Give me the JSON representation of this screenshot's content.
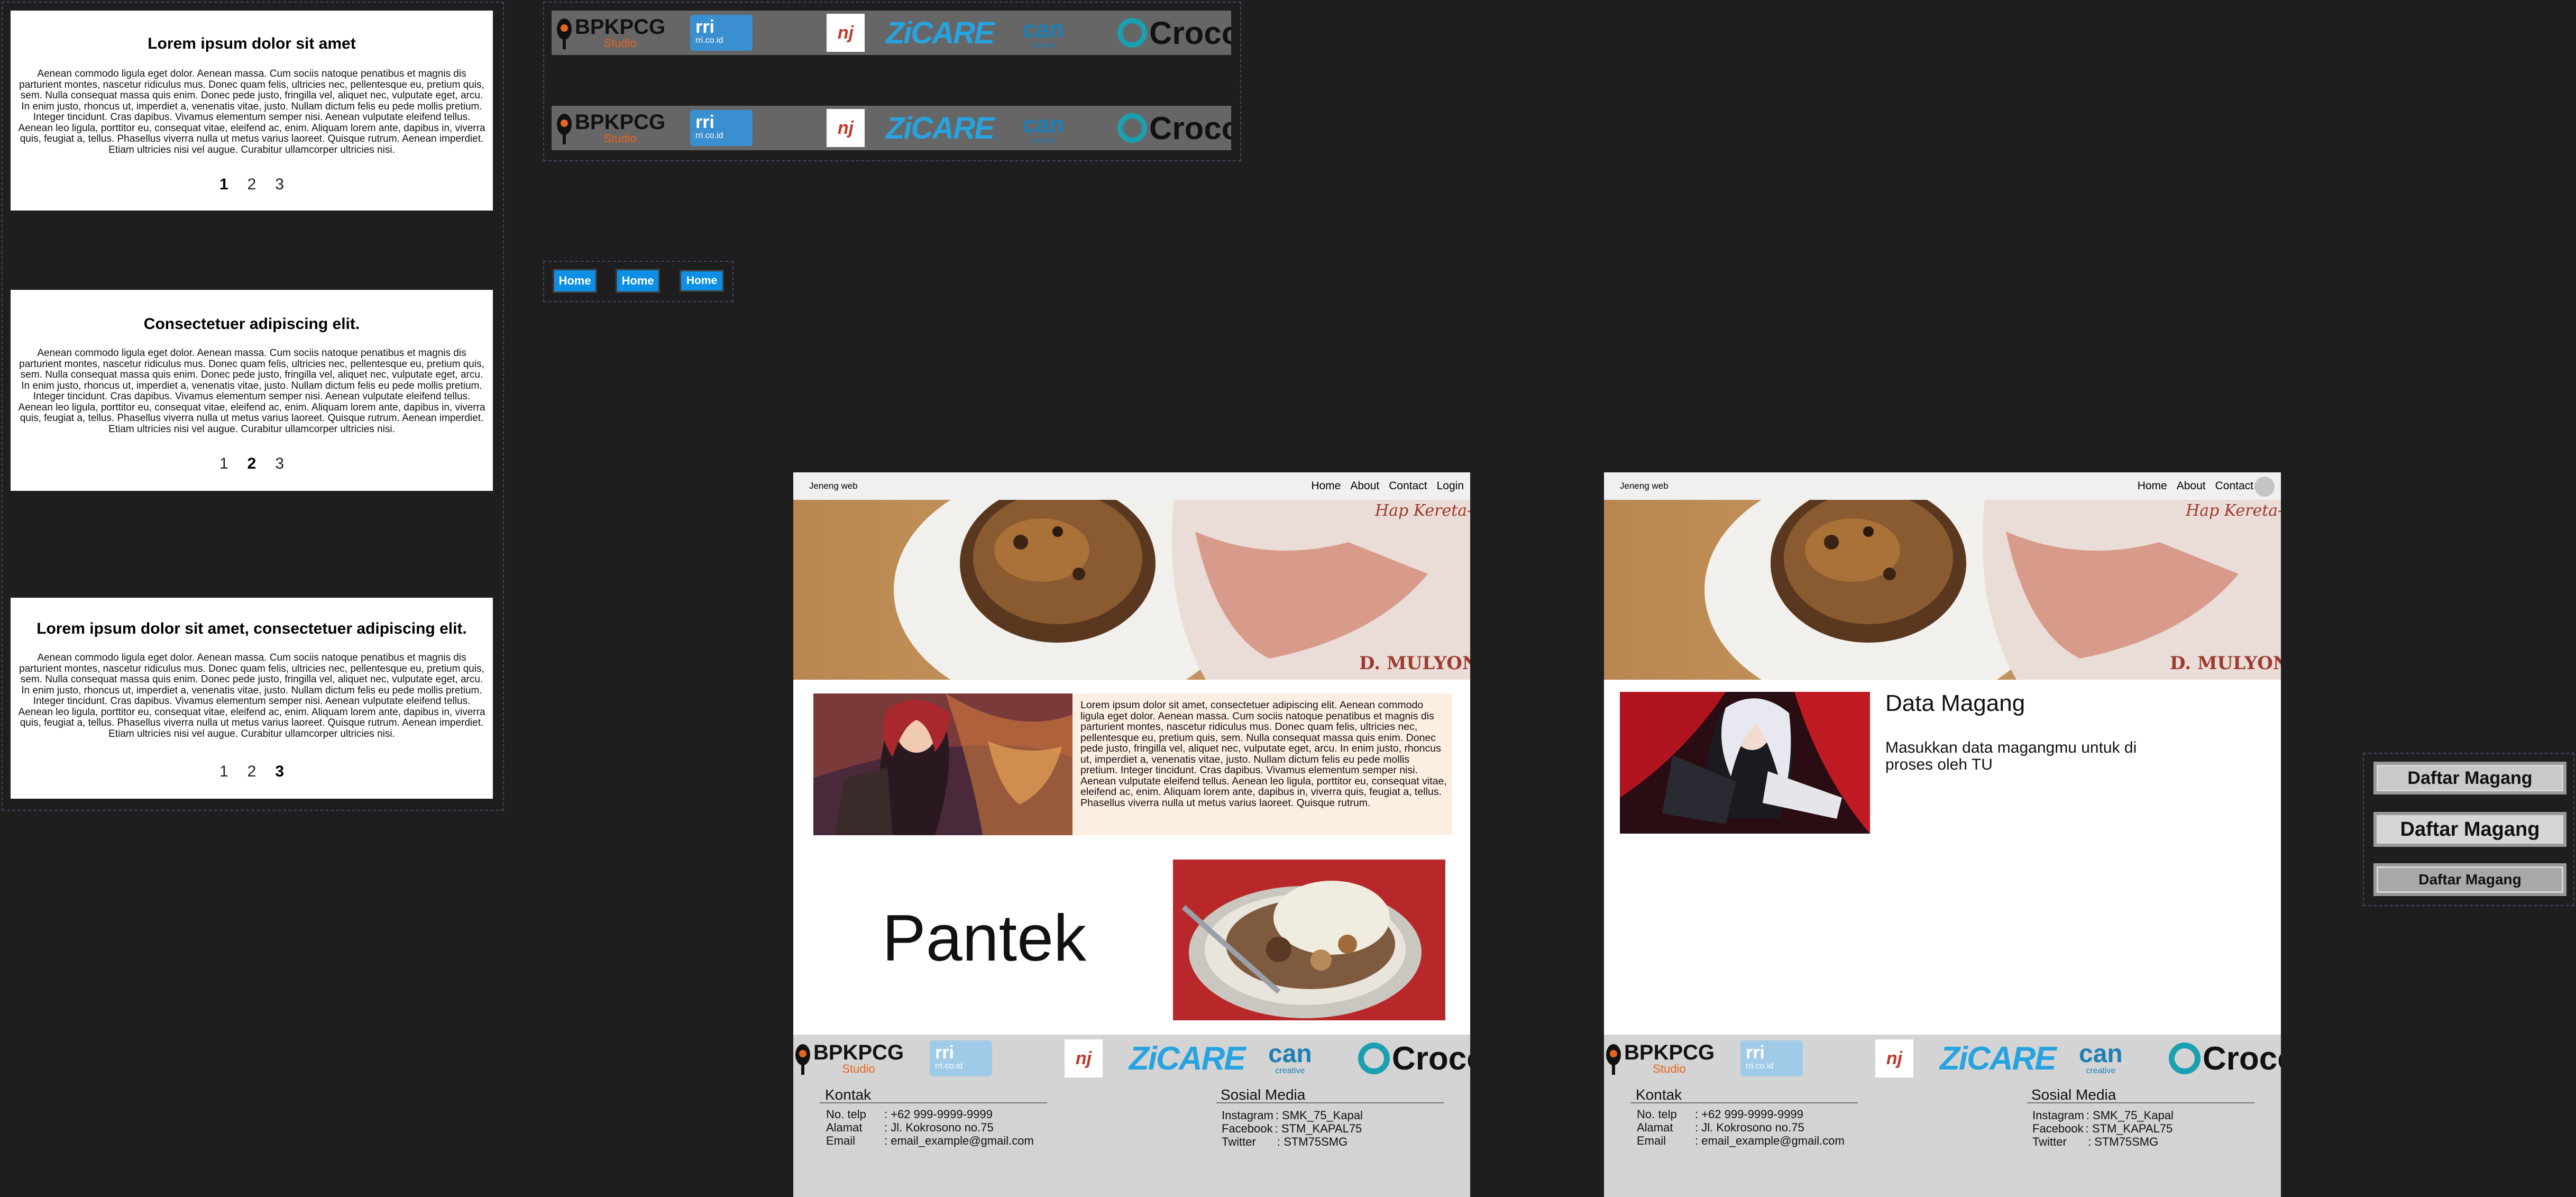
{
  "carousel": {
    "slides": [
      {
        "title": "Lorem ipsum dolor sit amet",
        "body": "Aenean commodo ligula eget dolor. Aenean massa. Cum sociis natoque penatibus et magnis dis parturient montes, nascetur ridiculus mus. Donec quam felis, ultricies nec, pellentesque eu, pretium quis, sem. Nulla consequat massa quis enim. Donec pede justo, fringilla vel, aliquet nec, vulputate eget, arcu. In enim justo, rhoncus ut, imperdiet a, venenatis vitae, justo. Nullam dictum felis eu pede mollis pretium. Integer tincidunt. Cras dapibus. Vivamus elementum semper nisi. Aenean vulputate eleifend tellus. Aenean leo ligula, porttitor eu, consequat vitae, eleifend ac, enim. Aliquam lorem ante, dapibus in, viverra quis, feugiat a, tellus. Phasellus viverra nulla ut metus varius laoreet. Quisque rutrum. Aenean imperdiet. Etiam ultricies nisi vel augue. Curabitur ullamcorper ultricies nisi.",
        "active_page": 1
      },
      {
        "title": "Consectetuer adipiscing elit.",
        "body": "Aenean commodo ligula eget dolor. Aenean massa. Cum sociis natoque penatibus et magnis dis parturient montes, nascetur ridiculus mus. Donec quam felis, ultricies nec, pellentesque eu, pretium quis, sem. Nulla consequat massa quis enim. Donec pede justo, fringilla vel, aliquet nec, vulputate eget, arcu. In enim justo, rhoncus ut, imperdiet a, venenatis vitae, justo. Nullam dictum felis eu pede mollis pretium. Integer tincidunt. Cras dapibus. Vivamus elementum semper nisi. Aenean vulputate eleifend tellus. Aenean leo ligula, porttitor eu, consequat vitae, eleifend ac, enim. Aliquam lorem ante, dapibus in, viverra quis, feugiat a, tellus. Phasellus viverra nulla ut metus varius laoreet. Quisque rutrum. Aenean imperdiet. Etiam ultricies nisi vel augue. Curabitur ullamcorper ultricies nisi.",
        "active_page": 2
      },
      {
        "title": "Lorem ipsum dolor sit amet, consectetuer adipiscing elit.",
        "body": "Aenean commodo ligula eget dolor. Aenean massa. Cum sociis natoque penatibus et magnis dis parturient montes, nascetur ridiculus mus. Donec quam felis, ultricies nec, pellentesque eu, pretium quis, sem. Nulla consequat massa quis enim. Donec pede justo, fringilla vel, aliquet nec, vulputate eget, arcu. In enim justo, rhoncus ut, imperdiet a, venenatis vitae, justo. Nullam dictum felis eu pede mollis pretium. Integer tincidunt. Cras dapibus. Vivamus elementum semper nisi. Aenean vulputate eleifend tellus. Aenean leo ligula, porttitor eu, consequat vitae, eleifend ac, enim. Aliquam lorem ante, dapibus in, viverra quis, feugiat a, tellus. Phasellus viverra nulla ut metus varius laoreet. Quisque rutrum. Aenean imperdiet. Etiam ultricies nisi vel augue. Curabitur ullamcorper ultricies nisi.",
        "active_page": 3
      }
    ],
    "pages": [
      "1",
      "2",
      "3"
    ]
  },
  "logos": {
    "bpkpcg": "BPKPCG",
    "studio": "Studio",
    "rri": "rri",
    "rri_url": "rri.co.id",
    "nj": "nj",
    "zicare": "ZiCARE",
    "can": "can",
    "creative": "creative",
    "croco": "Croco"
  },
  "home_buttons": [
    "Home",
    "Home",
    "Home"
  ],
  "daftar_buttons": [
    "Daftar Magang",
    "Daftar Magang",
    "Daftar Magang"
  ],
  "page1": {
    "brand": "Jeneng web",
    "nav": [
      "Home",
      "About",
      "Contact",
      "Login"
    ],
    "intro_text": "Lorem ipsum dolor sit amet, consectetuer adipiscing elit. Aenean commodo ligula eget dolor. Aenean massa. Cum sociis natoque penatibus et magnis dis parturient montes, nascetur ridiculus mus. Donec quam felis, ultricies nec, pellentesque eu, pretium quis, sem. Nulla consequat massa quis enim. Donec pede justo, fringilla vel, aliquet nec, vulputate eget, arcu. In enim justo, rhoncus ut, imperdiet a, venenatis vitae, justo. Nullam dictum felis eu pede mollis pretium. Integer tincidunt. Cras dapibus. Vivamus elementum semper nisi. Aenean vulputate eleifend tellus. Aenean leo ligula, porttitor eu, consequat vitae, eleifend ac, enim. Aliquam lorem ante, dapibus in, viverra quis, feugiat a, tellus. Phasellus viverra nulla ut metus varius laoreet. Quisque rutrum.",
    "big_word": "Pantek"
  },
  "page2": {
    "brand": "Jeneng web",
    "nav": [
      "Home",
      "About",
      "Contact"
    ],
    "heading": "Data Magang",
    "subtext": "Masukkan data magangmu untuk di proses oleh TU"
  },
  "hero": {
    "label_top": "Hap Kereta-Api",
    "label_bottom": "D. MULYONO"
  },
  "footer": {
    "kontak_title": "Kontak",
    "sosial_title": "Sosial Media",
    "kontak": [
      {
        "k": "No. telp",
        "v": ": +62 999-9999-9999"
      },
      {
        "k": "Alamat",
        "v": ": Jl. Kokrosono no.75"
      },
      {
        "k": "Email",
        "v": ": email_example@gmail.com"
      }
    ],
    "sosial": [
      {
        "k": "Instagram",
        "v": ": SMK_75_Kapal"
      },
      {
        "k": "Facebook",
        "v": ": STM_KAPAL75"
      },
      {
        "k": "Twitter",
        "v": ": STM75SMG"
      }
    ]
  },
  "colors": {
    "canvas": "#1e1e1e",
    "home_button": "#0d8fe6",
    "daftar_button": "#c9c9c9",
    "footer": "#d3d3d3",
    "frame_border": "#4a4160"
  }
}
